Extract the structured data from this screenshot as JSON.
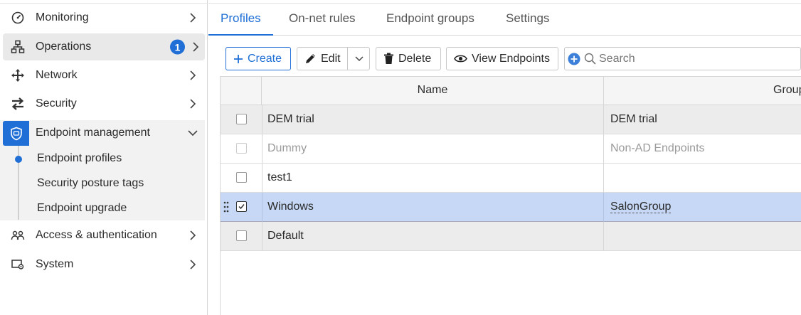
{
  "sidebar": {
    "items": [
      {
        "label": "Monitoring",
        "icon": "gauge-icon"
      },
      {
        "label": "Operations",
        "icon": "network-nodes-icon",
        "badge": "1"
      },
      {
        "label": "Network",
        "icon": "move-arrows-icon"
      },
      {
        "label": "Security",
        "icon": "swap-arrows-icon"
      },
      {
        "label": "Endpoint management",
        "icon": "shield-icon"
      },
      {
        "label": "Access & authentication",
        "icon": "users-icon"
      },
      {
        "label": "System",
        "icon": "system-gear-icon"
      }
    ],
    "endpoint_subitems": [
      "Endpoint profiles",
      "Security posture tags",
      "Endpoint upgrade"
    ]
  },
  "tabs": [
    "Profiles",
    "On-net rules",
    "Endpoint groups",
    "Settings"
  ],
  "toolbar": {
    "create": "Create",
    "edit": "Edit",
    "delete": "Delete",
    "view_endpoints": "View Endpoints",
    "search_placeholder": "Search"
  },
  "table": {
    "columns": [
      "Name",
      "Group"
    ],
    "rows": [
      {
        "name": "DEM trial",
        "group": "DEM trial",
        "state": "normal"
      },
      {
        "name": "Dummy",
        "group": "Non-AD Endpoints",
        "state": "disabled"
      },
      {
        "name": "test1",
        "group": "",
        "state": "normal"
      },
      {
        "name": "Windows",
        "group": "SalonGroup",
        "state": "selected"
      },
      {
        "name": "Default",
        "group": "",
        "state": "normal"
      }
    ]
  },
  "colors": {
    "accent": "#1f6fd6",
    "selected_row": "#c6d8f5"
  }
}
